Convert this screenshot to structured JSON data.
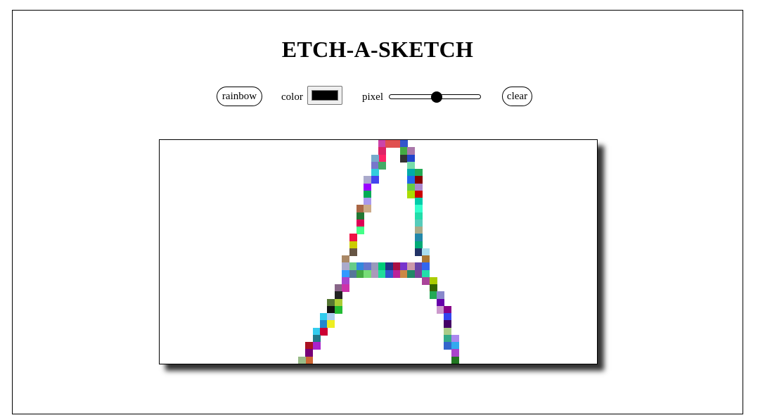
{
  "app": {
    "title": "ETCH-A-SKETCH"
  },
  "controls": {
    "rainbow_label": "rainbow",
    "color_label": "color",
    "color_value": "#000000",
    "pixel_label": "pixel",
    "pixel_slider_fraction": 0.52,
    "clear_label": "clear"
  },
  "sketch": {
    "grid_columns": 60,
    "grid_rows": 31,
    "cells": [
      {
        "col": 30,
        "row": 0,
        "color": "#cc44aa"
      },
      {
        "col": 31,
        "row": 0,
        "color": "#e05050"
      },
      {
        "col": 32,
        "row": 0,
        "color": "#e05050"
      },
      {
        "col": 33,
        "row": 0,
        "color": "#3355cc"
      },
      {
        "col": 30,
        "row": 1,
        "color": "#dd2266"
      },
      {
        "col": 33,
        "row": 1,
        "color": "#44aa44"
      },
      {
        "col": 34,
        "row": 1,
        "color": "#aa77aa"
      },
      {
        "col": 30,
        "row": 2,
        "color": "#ff2266"
      },
      {
        "col": 33,
        "row": 2,
        "color": "#333333"
      },
      {
        "col": 34,
        "row": 2,
        "color": "#2244cc"
      },
      {
        "col": 29,
        "row": 2,
        "color": "#77aacc"
      },
      {
        "col": 29,
        "row": 3,
        "color": "#7777cc"
      },
      {
        "col": 30,
        "row": 3,
        "color": "#44aa66"
      },
      {
        "col": 34,
        "row": 3,
        "color": "#77ddaa"
      },
      {
        "col": 29,
        "row": 4,
        "color": "#33ccdd"
      },
      {
        "col": 34,
        "row": 4,
        "color": "#00aaaa"
      },
      {
        "col": 35,
        "row": 4,
        "color": "#22aa55"
      },
      {
        "col": 28,
        "row": 5,
        "color": "#aaaacc"
      },
      {
        "col": 29,
        "row": 5,
        "color": "#4444ee"
      },
      {
        "col": 34,
        "row": 5,
        "color": "#2266ee"
      },
      {
        "col": 35,
        "row": 5,
        "color": "#880000"
      },
      {
        "col": 28,
        "row": 6,
        "color": "#9900ff"
      },
      {
        "col": 34,
        "row": 6,
        "color": "#66cc44"
      },
      {
        "col": 35,
        "row": 6,
        "color": "#aa88cc"
      },
      {
        "col": 28,
        "row": 7,
        "color": "#00aa55"
      },
      {
        "col": 34,
        "row": 7,
        "color": "#aadd00"
      },
      {
        "col": 35,
        "row": 7,
        "color": "#cc0000"
      },
      {
        "col": 28,
        "row": 8,
        "color": "#aa99ee"
      },
      {
        "col": 35,
        "row": 8,
        "color": "#00ccaa"
      },
      {
        "col": 27,
        "row": 9,
        "color": "#aa6644"
      },
      {
        "col": 28,
        "row": 9,
        "color": "#ccaa88"
      },
      {
        "col": 35,
        "row": 9,
        "color": "#33ffcc"
      },
      {
        "col": 27,
        "row": 10,
        "color": "#227733"
      },
      {
        "col": 35,
        "row": 10,
        "color": "#22ddaa"
      },
      {
        "col": 27,
        "row": 11,
        "color": "#dd0055"
      },
      {
        "col": 35,
        "row": 11,
        "color": "#55ccbb"
      },
      {
        "col": 27,
        "row": 12,
        "color": "#44ff88"
      },
      {
        "col": 35,
        "row": 12,
        "color": "#aaaa88"
      },
      {
        "col": 26,
        "row": 13,
        "color": "#ee1144"
      },
      {
        "col": 35,
        "row": 13,
        "color": "#2288aa"
      },
      {
        "col": 26,
        "row": 14,
        "color": "#cccc00"
      },
      {
        "col": 35,
        "row": 14,
        "color": "#00aa77"
      },
      {
        "col": 26,
        "row": 15,
        "color": "#665544"
      },
      {
        "col": 35,
        "row": 15,
        "color": "#223366"
      },
      {
        "col": 36,
        "row": 15,
        "color": "#aaddee"
      },
      {
        "col": 25,
        "row": 16,
        "color": "#aa8866"
      },
      {
        "col": 36,
        "row": 16,
        "color": "#aa7733"
      },
      {
        "col": 25,
        "row": 17,
        "color": "#aaaacc"
      },
      {
        "col": 26,
        "row": 17,
        "color": "#66cc88"
      },
      {
        "col": 27,
        "row": 17,
        "color": "#3388dd"
      },
      {
        "col": 28,
        "row": 17,
        "color": "#6677cc"
      },
      {
        "col": 29,
        "row": 17,
        "color": "#9999bb"
      },
      {
        "col": 30,
        "row": 17,
        "color": "#00cc77"
      },
      {
        "col": 31,
        "row": 17,
        "color": "#223388"
      },
      {
        "col": 32,
        "row": 17,
        "color": "#aa1144"
      },
      {
        "col": 33,
        "row": 17,
        "color": "#7733cc"
      },
      {
        "col": 34,
        "row": 17,
        "color": "#cc99aa"
      },
      {
        "col": 35,
        "row": 17,
        "color": "#6644aa"
      },
      {
        "col": 36,
        "row": 17,
        "color": "#3366ee"
      },
      {
        "col": 25,
        "row": 18,
        "color": "#3399ff"
      },
      {
        "col": 26,
        "row": 18,
        "color": "#557799"
      },
      {
        "col": 27,
        "row": 18,
        "color": "#44aa44"
      },
      {
        "col": 28,
        "row": 18,
        "color": "#77dd77"
      },
      {
        "col": 29,
        "row": 18,
        "color": "#aa99bb"
      },
      {
        "col": 30,
        "row": 18,
        "color": "#22dd99"
      },
      {
        "col": 31,
        "row": 18,
        "color": "#3355cc"
      },
      {
        "col": 32,
        "row": 18,
        "color": "#bb2299"
      },
      {
        "col": 33,
        "row": 18,
        "color": "#cc8844"
      },
      {
        "col": 34,
        "row": 18,
        "color": "#228866"
      },
      {
        "col": 35,
        "row": 18,
        "color": "#774499"
      },
      {
        "col": 36,
        "row": 18,
        "color": "#22ddaa"
      },
      {
        "col": 36,
        "row": 19,
        "color": "#aa4499"
      },
      {
        "col": 37,
        "row": 19,
        "color": "#aacc00"
      },
      {
        "col": 25,
        "row": 19,
        "color": "#aa44cc"
      },
      {
        "col": 24,
        "row": 20,
        "color": "#886688"
      },
      {
        "col": 25,
        "row": 20,
        "color": "#cc33aa"
      },
      {
        "col": 37,
        "row": 20,
        "color": "#336600"
      },
      {
        "col": 24,
        "row": 21,
        "color": "#222222"
      },
      {
        "col": 37,
        "row": 21,
        "color": "#22aa55"
      },
      {
        "col": 38,
        "row": 21,
        "color": "#8888cc"
      },
      {
        "col": 23,
        "row": 22,
        "color": "#557733"
      },
      {
        "col": 24,
        "row": 22,
        "color": "#aacc33"
      },
      {
        "col": 38,
        "row": 22,
        "color": "#6600aa"
      },
      {
        "col": 23,
        "row": 23,
        "color": "#111111"
      },
      {
        "col": 24,
        "row": 23,
        "color": "#22bb33"
      },
      {
        "col": 38,
        "row": 23,
        "color": "#cc99cc"
      },
      {
        "col": 39,
        "row": 23,
        "color": "#880088"
      },
      {
        "col": 22,
        "row": 24,
        "color": "#33ccee"
      },
      {
        "col": 23,
        "row": 24,
        "color": "#aaccee"
      },
      {
        "col": 39,
        "row": 24,
        "color": "#3344ee"
      },
      {
        "col": 22,
        "row": 25,
        "color": "#2288cc"
      },
      {
        "col": 23,
        "row": 25,
        "color": "#eeee22"
      },
      {
        "col": 39,
        "row": 25,
        "color": "#440066"
      },
      {
        "col": 21,
        "row": 26,
        "color": "#33ccee"
      },
      {
        "col": 22,
        "row": 26,
        "color": "#cc0033"
      },
      {
        "col": 39,
        "row": 26,
        "color": "#aacc88"
      },
      {
        "col": 21,
        "row": 27,
        "color": "#227788"
      },
      {
        "col": 39,
        "row": 27,
        "color": "#33aa88"
      },
      {
        "col": 40,
        "row": 27,
        "color": "#aa88ee"
      },
      {
        "col": 20,
        "row": 28,
        "color": "#aa1122"
      },
      {
        "col": 21,
        "row": 28,
        "color": "#aa22cc"
      },
      {
        "col": 39,
        "row": 28,
        "color": "#3366cc"
      },
      {
        "col": 40,
        "row": 28,
        "color": "#33aaee"
      },
      {
        "col": 20,
        "row": 29,
        "color": "#770077"
      },
      {
        "col": 40,
        "row": 29,
        "color": "#aa44cc"
      },
      {
        "col": 20,
        "row": 30,
        "color": "#cc6633"
      },
      {
        "col": 40,
        "row": 30,
        "color": "#227722"
      },
      {
        "col": 19,
        "row": 30,
        "color": "#99bb88"
      }
    ]
  }
}
